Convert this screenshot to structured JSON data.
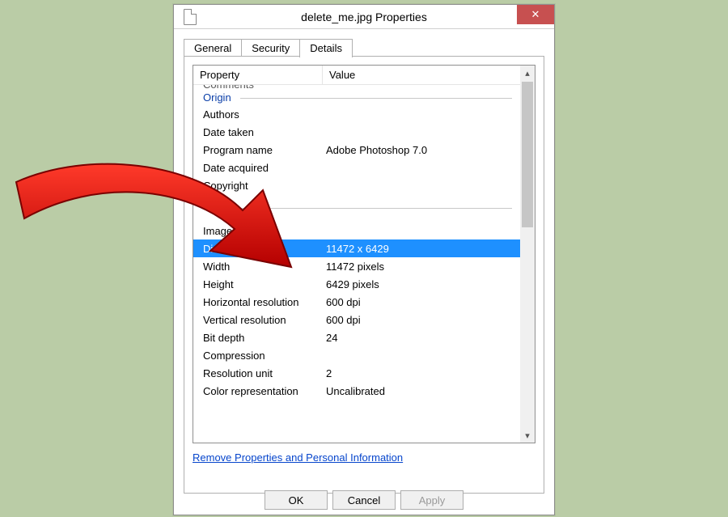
{
  "window": {
    "title": "delete_me.jpg Properties"
  },
  "tabs": {
    "general": "General",
    "security": "Security",
    "details": "Details",
    "active": "details"
  },
  "headers": {
    "property": "Property",
    "value": "Value"
  },
  "groups": {
    "origin": "Origin"
  },
  "rows": {
    "comments_cut": "Comments",
    "authors": "Authors",
    "date_taken": "Date taken",
    "program_name": {
      "label": "Program name",
      "value": "Adobe Photoshop 7.0"
    },
    "date_acquired": "Date acquired",
    "copyright": "Copyright",
    "image_id": "Image ID",
    "dimensions": {
      "label": "Dimensions",
      "value": "11472 x 6429"
    },
    "width": {
      "label": "Width",
      "value": "11472 pixels"
    },
    "height": {
      "label": "Height",
      "value": "6429 pixels"
    },
    "h_res": {
      "label": "Horizontal resolution",
      "value": "600 dpi"
    },
    "v_res": {
      "label": "Vertical resolution",
      "value": "600 dpi"
    },
    "bit_depth": {
      "label": "Bit depth",
      "value": "24"
    },
    "compression": "Compression",
    "res_unit": {
      "label": "Resolution unit",
      "value": "2"
    },
    "color_rep": {
      "label": "Color representation",
      "value": "Uncalibrated"
    }
  },
  "link": "Remove Properties and Personal Information",
  "buttons": {
    "ok": "OK",
    "cancel": "Cancel",
    "apply": "Apply"
  }
}
